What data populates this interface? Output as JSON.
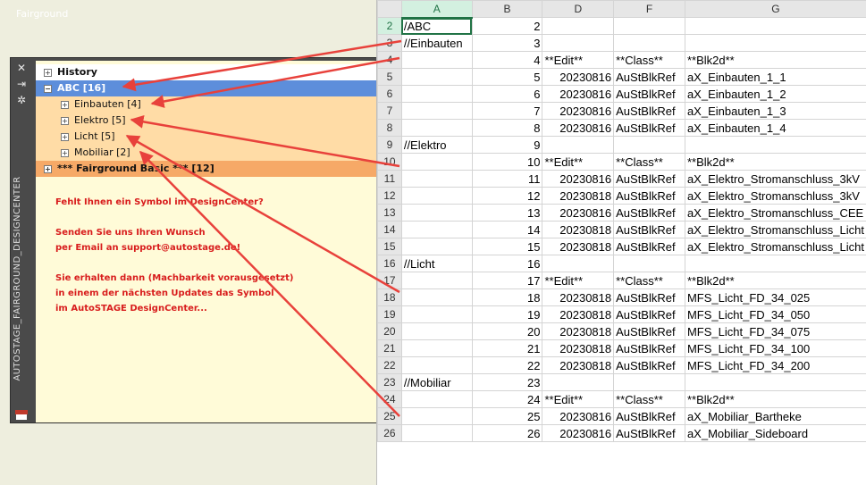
{
  "left": {
    "top_title": "Fairground",
    "vertical_title": "AUTOSTAGE_FAIRGROUND_DESIGNCENTER",
    "sidebar_icons": [
      "close-icon",
      "pin-icon",
      "settings-icon"
    ],
    "tree": {
      "history": "History",
      "abc": "ABC  [16]",
      "items": [
        {
          "label": "Einbauten  [4]"
        },
        {
          "label": "Elektro  [5]"
        },
        {
          "label": "Licht  [5]"
        },
        {
          "label": "Mobiliar  [2]"
        }
      ],
      "fairground": "*** Fairground Basic ***  [12]"
    },
    "message": [
      "Fehlt Ihnen ein Symbol im DesignCenter?",
      "",
      "Senden Sie uns Ihren Wunsch",
      "per Email an support@autostage.de!",
      "",
      "Sie erhalten dann (Machbarkeit vorausgesetzt)",
      "in einem der nächsten Updates das Symbol",
      "im AutoSTAGE DesignCenter..."
    ]
  },
  "sheet": {
    "columns": [
      "A",
      "B",
      "D",
      "F",
      "G"
    ],
    "rows": [
      {
        "n": "2",
        "a": "/ABC",
        "b": "2",
        "d": "",
        "f": "",
        "g": ""
      },
      {
        "n": "3",
        "a": "//Einbauten",
        "b": "3",
        "d": "",
        "f": "",
        "g": ""
      },
      {
        "n": "4",
        "a": "",
        "b": "4",
        "d": "**Edit**",
        "f": "**Class**",
        "g": "**Blk2d**"
      },
      {
        "n": "5",
        "a": "",
        "b": "5",
        "d": "20230816",
        "f": "AuStBlkRef",
        "g": "aX_Einbauten_1_1"
      },
      {
        "n": "6",
        "a": "",
        "b": "6",
        "d": "20230816",
        "f": "AuStBlkRef",
        "g": "aX_Einbauten_1_2"
      },
      {
        "n": "7",
        "a": "",
        "b": "7",
        "d": "20230816",
        "f": "AuStBlkRef",
        "g": "aX_Einbauten_1_3"
      },
      {
        "n": "8",
        "a": "",
        "b": "8",
        "d": "20230816",
        "f": "AuStBlkRef",
        "g": "aX_Einbauten_1_4"
      },
      {
        "n": "9",
        "a": "//Elektro",
        "b": "9",
        "d": "",
        "f": "",
        "g": ""
      },
      {
        "n": "10",
        "a": "",
        "b": "10",
        "d": "**Edit**",
        "f": "**Class**",
        "g": "**Blk2d**"
      },
      {
        "n": "11",
        "a": "",
        "b": "11",
        "d": "20230816",
        "f": "AuStBlkRef",
        "g": "aX_Elektro_Stromanschluss_3kV"
      },
      {
        "n": "12",
        "a": "",
        "b": "12",
        "d": "20230818",
        "f": "AuStBlkRef",
        "g": "aX_Elektro_Stromanschluss_3kV"
      },
      {
        "n": "13",
        "a": "",
        "b": "13",
        "d": "20230816",
        "f": "AuStBlkRef",
        "g": "aX_Elektro_Stromanschluss_CEE"
      },
      {
        "n": "14",
        "a": "",
        "b": "14",
        "d": "20230818",
        "f": "AuStBlkRef",
        "g": "aX_Elektro_Stromanschluss_Licht"
      },
      {
        "n": "15",
        "a": "",
        "b": "15",
        "d": "20230818",
        "f": "AuStBlkRef",
        "g": "aX_Elektro_Stromanschluss_Licht"
      },
      {
        "n": "16",
        "a": "//Licht",
        "b": "16",
        "d": "",
        "f": "",
        "g": ""
      },
      {
        "n": "17",
        "a": "",
        "b": "17",
        "d": "**Edit**",
        "f": "**Class**",
        "g": "**Blk2d**"
      },
      {
        "n": "18",
        "a": "",
        "b": "18",
        "d": "20230818",
        "f": "AuStBlkRef",
        "g": "MFS_Licht_FD_34_025"
      },
      {
        "n": "19",
        "a": "",
        "b": "19",
        "d": "20230818",
        "f": "AuStBlkRef",
        "g": "MFS_Licht_FD_34_050"
      },
      {
        "n": "20",
        "a": "",
        "b": "20",
        "d": "20230818",
        "f": "AuStBlkRef",
        "g": "MFS_Licht_FD_34_075"
      },
      {
        "n": "21",
        "a": "",
        "b": "21",
        "d": "20230818",
        "f": "AuStBlkRef",
        "g": "MFS_Licht_FD_34_100"
      },
      {
        "n": "22",
        "a": "",
        "b": "22",
        "d": "20230818",
        "f": "AuStBlkRef",
        "g": "MFS_Licht_FD_34_200"
      },
      {
        "n": "23",
        "a": "//Mobiliar",
        "b": "23",
        "d": "",
        "f": "",
        "g": ""
      },
      {
        "n": "24",
        "a": "",
        "b": "24",
        "d": "**Edit**",
        "f": "**Class**",
        "g": "**Blk2d**"
      },
      {
        "n": "25",
        "a": "",
        "b": "25",
        "d": "20230816",
        "f": "AuStBlkRef",
        "g": "aX_Mobiliar_Bartheke"
      },
      {
        "n": "26",
        "a": "",
        "b": "26",
        "d": "20230816",
        "f": "AuStBlkRef",
        "g": "aX_Mobiliar_Sideboard"
      }
    ]
  },
  "colors": {
    "abc_row": "#5d8edb",
    "category_block": "#ffdca6",
    "fairground_row": "#f6a967",
    "message_text": "#d81c1c",
    "arrow": "#e8413b",
    "excel_green": "#217346"
  }
}
